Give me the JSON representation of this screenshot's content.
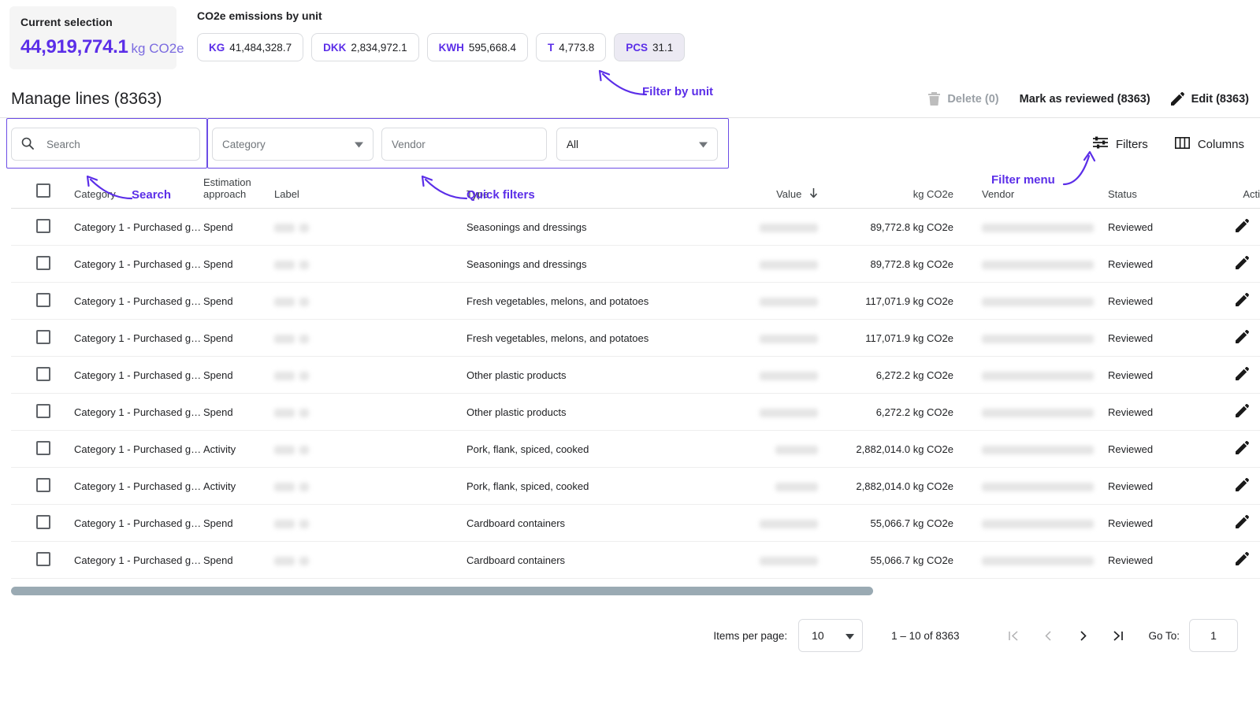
{
  "summary": {
    "current_selection_title": "Current selection",
    "current_selection_value": "44,919,774.1",
    "current_selection_unit": "kg CO2e",
    "units_title": "CO2e emissions by unit",
    "unit_chips": [
      {
        "code": "KG",
        "value": "41,484,328.7",
        "selected": false
      },
      {
        "code": "DKK",
        "value": "2,834,972.1",
        "selected": false
      },
      {
        "code": "KWH",
        "value": "595,668.4",
        "selected": false
      },
      {
        "code": "T",
        "value": "4,773.8",
        "selected": false
      },
      {
        "code": "PCS",
        "value": "31.1",
        "selected": true
      }
    ]
  },
  "header": {
    "title": "Manage lines (8363)",
    "delete_label": "Delete (0)",
    "mark_reviewed_label": "Mark as reviewed (8363)",
    "edit_label": "Edit (8363)"
  },
  "filters": {
    "search_placeholder": "Search",
    "search_value": "",
    "category_placeholder": "Category",
    "vendor_placeholder": "Vendor",
    "all_value": "All",
    "filters_label": "Filters",
    "columns_label": "Columns"
  },
  "table": {
    "columns": [
      "Category",
      "Estimation approach",
      "Label",
      "Type",
      "Value",
      "kg CO2e",
      "Vendor",
      "Status",
      "Actions"
    ],
    "sorted_column": "Value",
    "sort_direction": "desc",
    "rows": [
      {
        "category": "Category 1 - Purchased g…",
        "estimation": "Spend",
        "label": "",
        "type": "Seasonings and dressings",
        "value": "",
        "co2e": "89,772.8 kg CO2e",
        "vendor": "",
        "status": "Reviewed"
      },
      {
        "category": "Category 1 - Purchased g…",
        "estimation": "Spend",
        "label": "",
        "type": "Seasonings and dressings",
        "value": "",
        "co2e": "89,772.8 kg CO2e",
        "vendor": "",
        "status": "Reviewed"
      },
      {
        "category": "Category 1 - Purchased g…",
        "estimation": "Spend",
        "label": "",
        "type": "Fresh vegetables, melons, and potatoes",
        "value": "",
        "co2e": "117,071.9 kg CO2e",
        "vendor": "",
        "status": "Reviewed"
      },
      {
        "category": "Category 1 - Purchased g…",
        "estimation": "Spend",
        "label": "",
        "type": "Fresh vegetables, melons, and potatoes",
        "value": "",
        "co2e": "117,071.9 kg CO2e",
        "vendor": "",
        "status": "Reviewed"
      },
      {
        "category": "Category 1 - Purchased g…",
        "estimation": "Spend",
        "label": "",
        "type": "Other plastic products",
        "value": "",
        "co2e": "6,272.2 kg CO2e",
        "vendor": "",
        "status": "Reviewed"
      },
      {
        "category": "Category 1 - Purchased g…",
        "estimation": "Spend",
        "label": "",
        "type": "Other plastic products",
        "value": "",
        "co2e": "6,272.2 kg CO2e",
        "vendor": "",
        "status": "Reviewed"
      },
      {
        "category": "Category 1 - Purchased g…",
        "estimation": "Activity",
        "label": "",
        "type": "Pork, flank, spiced, cooked",
        "value": "",
        "co2e": "2,882,014.0 kg CO2e",
        "vendor": "",
        "status": "Reviewed"
      },
      {
        "category": "Category 1 - Purchased g…",
        "estimation": "Activity",
        "label": "",
        "type": "Pork, flank, spiced, cooked",
        "value": "",
        "co2e": "2,882,014.0 kg CO2e",
        "vendor": "",
        "status": "Reviewed"
      },
      {
        "category": "Category 1 - Purchased g…",
        "estimation": "Spend",
        "label": "",
        "type": "Cardboard containers",
        "value": "",
        "co2e": "55,066.7 kg CO2e",
        "vendor": "",
        "status": "Reviewed"
      },
      {
        "category": "Category 1 - Purchased g…",
        "estimation": "Spend",
        "label": "",
        "type": "Cardboard containers",
        "value": "",
        "co2e": "55,066.7 kg CO2e",
        "vendor": "",
        "status": "Reviewed"
      }
    ]
  },
  "pagination": {
    "items_per_page_label": "Items per page:",
    "items_per_page_value": "10",
    "range_label": "1 – 10 of 8363",
    "goto_label": "Go To:",
    "goto_value": "1"
  },
  "annotations": [
    {
      "text": "Filter by unit"
    },
    {
      "text": "Search"
    },
    {
      "text": "Quick filters"
    },
    {
      "text": "Filter menu"
    }
  ],
  "colors": {
    "accent": "#5b2ee8",
    "annotation": "#5b2ee8",
    "selected_chip_bg": "#eceaf3",
    "scrollbar": "#9aaab3"
  }
}
